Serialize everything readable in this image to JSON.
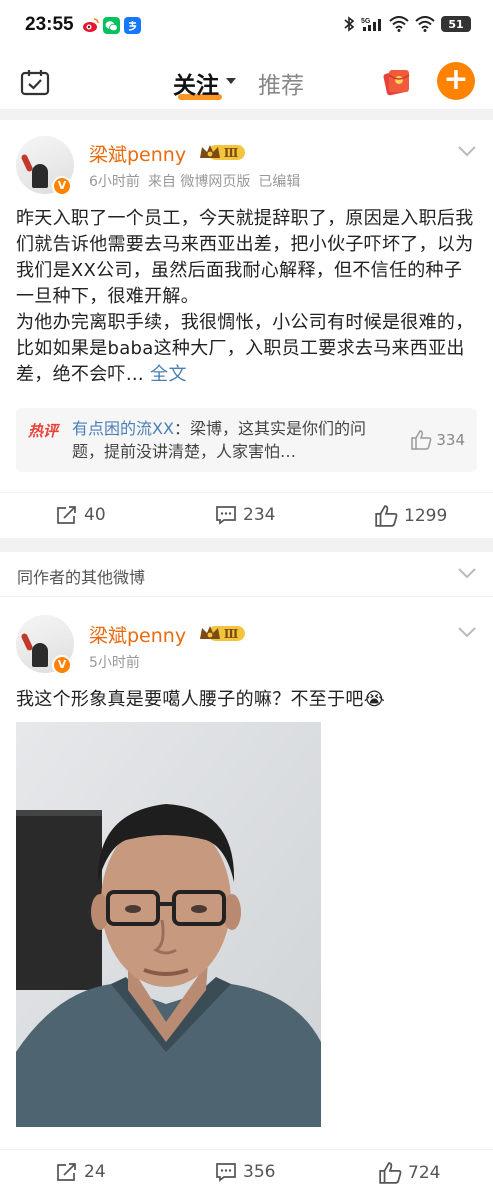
{
  "status_bar": {
    "time": "23:55",
    "battery": "51",
    "network": "5G"
  },
  "nav": {
    "tab_follow": "关注",
    "tab_recommend": "推荐",
    "accent_color": "#ff8200"
  },
  "posts": [
    {
      "username": "梁斌penny",
      "level": "Ⅲ",
      "meta": [
        "6小时前",
        "来自 微博网页版",
        "已编辑"
      ],
      "text": "昨天入职了一个员工，今天就提辞职了，原因是入职后我们就告诉他需要去马来西亚出差，把小伙子吓坏了，以为我们是XX公司，虽然后面我耐心解释，但不信任的种子一旦种下，很难开解。\n为他办完离职手续，我很惆怅，小公司有时候是很难的，比如如果是baba这种大厂，入职员工要求去马来西亚出差，绝不会吓…",
      "full_text_link": "全文",
      "hot_comment": {
        "tag": "热评",
        "user": "有点困的流XX",
        "text": "：梁博，这其实是你们的问题，提前没讲清楚，人家害怕…",
        "likes": "334"
      },
      "reposts": "40",
      "comments": "234",
      "likes": "1299"
    },
    {
      "username": "梁斌penny",
      "level": "Ⅲ",
      "meta": [
        "5小时前"
      ],
      "text": "我这个形象真是要噶人腰子的嘛？不至于吧😭",
      "reposts": "24",
      "comments": "356",
      "likes": "724"
    }
  ],
  "section": {
    "title": "同作者的其他微博"
  }
}
